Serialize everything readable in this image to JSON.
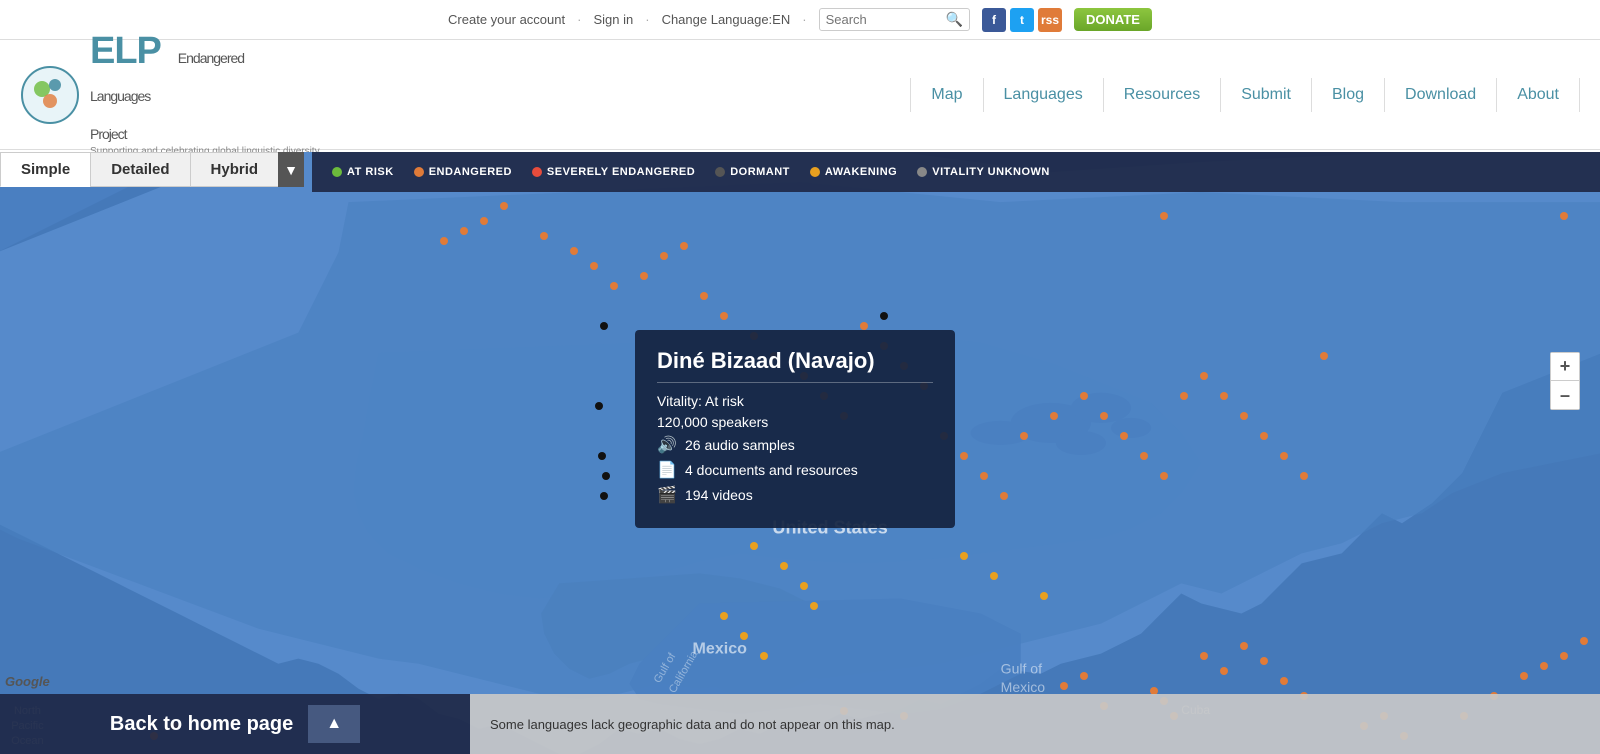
{
  "topbar": {
    "create_account": "Create your account",
    "sign_in": "Sign in",
    "change_language": "Change Language:EN",
    "search_placeholder": "Search",
    "donate_label": "DONATE"
  },
  "header": {
    "logo_text": "ELP",
    "logo_full": "Endangered Languages Project",
    "logo_tagline": "Supporting and celebrating global linguistic diversity",
    "nav": {
      "map": "Map",
      "languages": "Languages",
      "resources": "Resources",
      "submit": "Submit",
      "blog": "Blog",
      "download": "Download",
      "about": "About"
    }
  },
  "map_tabs": {
    "simple": "Simple",
    "detailed": "Detailed",
    "hybrid": "Hybrid"
  },
  "legend": {
    "items": [
      {
        "label": "AT RISK",
        "color": "#6cbb3c"
      },
      {
        "label": "ENDANGERED",
        "color": "#e07b39"
      },
      {
        "label": "SEVERELY ENDANGERED",
        "color": "#e74c3c"
      },
      {
        "label": "DORMANT",
        "color": "#555"
      },
      {
        "label": "AWAKENING",
        "color": "#e8a020"
      },
      {
        "label": "VITALITY UNKNOWN",
        "color": "#888"
      }
    ]
  },
  "popup": {
    "title": "Diné Bizaad (Navajo)",
    "vitality": "Vitality: At risk",
    "speakers": "120,000 speakers",
    "audio_samples": "26 audio samples",
    "documents": "4 documents and resources",
    "videos": "194 videos"
  },
  "zoom": {
    "plus": "+",
    "minus": "–"
  },
  "bottom": {
    "back_label": "Back to home page",
    "arrow": "▲",
    "geo_notice": "Some languages lack geographic data and do not appear on this map."
  },
  "map_labels": {
    "united_states": "United States",
    "mexico": "Mexico",
    "gulf_california": "Gulf of California",
    "gulf_mexico": "Gulf of Mexico",
    "north_pacific": "North Pacific Ocean",
    "cuba": "Cuba"
  },
  "google_logo": "Google"
}
